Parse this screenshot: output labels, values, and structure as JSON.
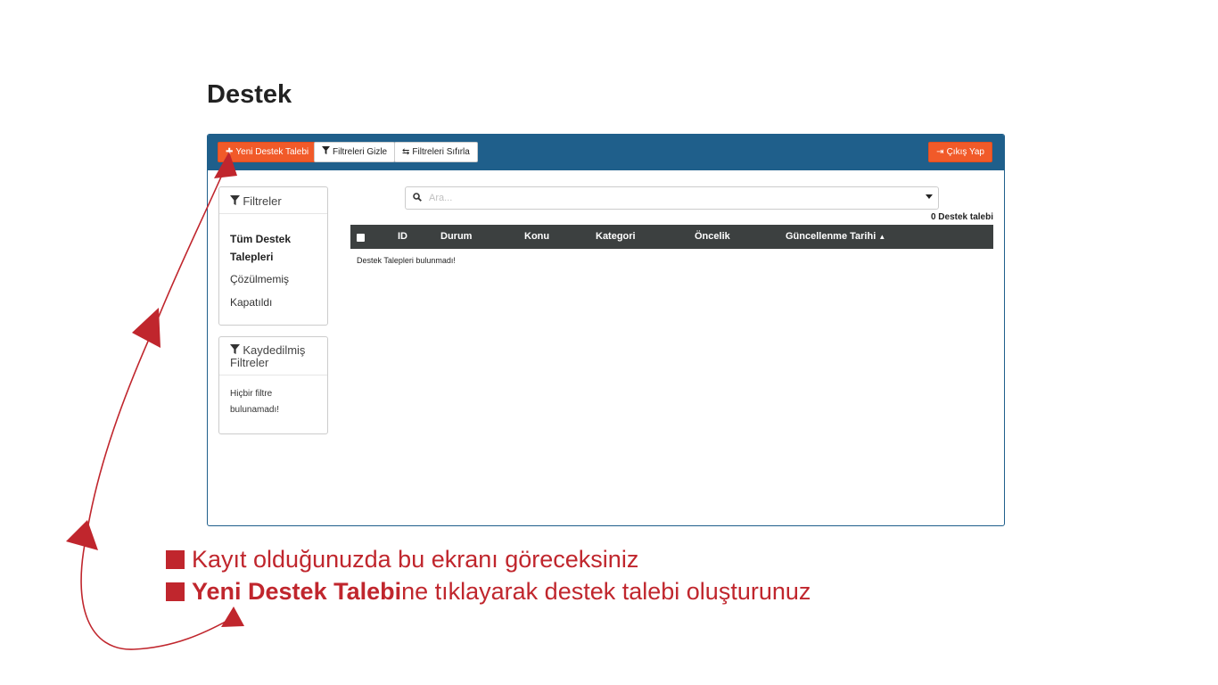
{
  "page_title": "Destek",
  "toolbar": {
    "new_ticket": "Yeni Destek Talebi",
    "hide_filters": "Filtreleri Gizle",
    "reset_filters": "Filtreleri Sıfırla",
    "logout": "Çıkış Yap"
  },
  "filters_box": {
    "title": "Filtreler",
    "items": [
      "Tüm Destek Talepleri",
      "Çözülmemiş",
      "Kapatıldı"
    ]
  },
  "saved_filters_box": {
    "title": "Kaydedilmiş Filtreler",
    "empty": "Hiçbir filtre bulunamadı!"
  },
  "search": {
    "placeholder": "Ara..."
  },
  "ticket_count": "0 Destek talebi",
  "table": {
    "columns": [
      "ID",
      "Durum",
      "Konu",
      "Kategori",
      "Öncelik",
      "Güncellenme Tarihi"
    ],
    "sort_indicator": "▲",
    "empty_message": "Destek Talepleri bulunmadı!"
  },
  "instructions": {
    "line1": "Kayıt olduğunuzda bu ekranı göreceksiniz",
    "line2_bold": "Yeni Destek Talebi",
    "line2_rest": "ne tıklayarak destek talebi oluşturunuz"
  },
  "colors": {
    "toolbar": "#1f5f8b",
    "accent_orange": "#f15a29",
    "table_header": "#3c4040",
    "annotation_red": "#c0262d"
  },
  "icons": [
    "plus-icon",
    "funnel-icon",
    "retweet-icon",
    "sign-out-icon",
    "search-icon",
    "caret-down-icon",
    "sort-up-icon"
  ]
}
